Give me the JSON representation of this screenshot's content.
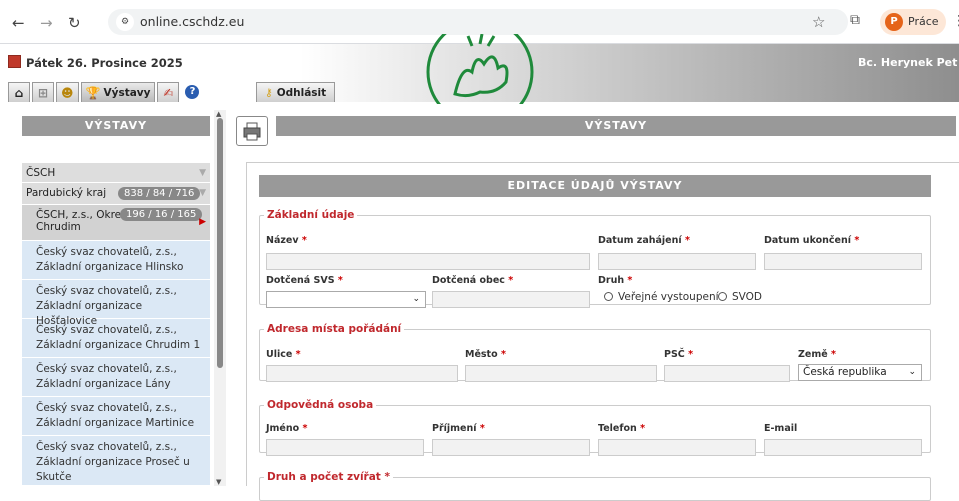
{
  "browser": {
    "url": "online.cschdz.eu",
    "profile_name": "Práce",
    "profile_initial": "P"
  },
  "header": {
    "date": "Pátek 26. Prosince 2025",
    "user": "Bc. Herynek Pet",
    "tabs": [
      {
        "icon": "home-icon",
        "label": ""
      },
      {
        "icon": "sitemap-icon",
        "label": ""
      },
      {
        "icon": "people-icon",
        "label": ""
      },
      {
        "icon": "trophy-icon",
        "label": "Výstavy"
      },
      {
        "icon": "pen-icon",
        "label": ""
      },
      {
        "icon": "help-icon",
        "label": ""
      }
    ],
    "logout": "Odhlásit"
  },
  "sidebar": {
    "title": "VÝSTAVY",
    "tree": {
      "root": "ČSCH",
      "region": {
        "label": "Pardubický kraj",
        "counts": "838 / 84 / 716"
      },
      "district": {
        "label": "ČSCH, z.s., Okresní",
        "label2": "Chrudim",
        "counts": "196 / 16 / 165"
      }
    },
    "orgs": [
      {
        "line1": "Český svaz chovatelů, z.s.,",
        "line2": "Základní organizace Hlinsko"
      },
      {
        "line1": "Český svaz chovatelů, z.s.,",
        "line2": "Základní organizace Hošťalovice"
      },
      {
        "line1": "Český svaz chovatelů, z.s.,",
        "line2": "Základní organizace Chrudim 1"
      },
      {
        "line1": "Český svaz chovatelů, z.s.,",
        "line2": "Základní organizace Lány"
      },
      {
        "line1": "Český svaz chovatelů, z.s.,",
        "line2": "Základní organizace Martinice"
      },
      {
        "line1": "Český svaz chovatelů, z.s.,",
        "line2": "Základní organizace Proseč u",
        "line3": "Skutče"
      }
    ]
  },
  "main": {
    "title": "VÝSTAVY",
    "panel_title": "EDITACE ÚDAJŮ VÝSTAVY",
    "basic": {
      "legend": "Základní údaje",
      "name": "Název",
      "start": "Datum zahájení",
      "end": "Datum ukončení",
      "svs": "Dotčená SVS",
      "obec": "Dotčená obec",
      "druh": "Druh",
      "radio1": "Veřejné vystoupení",
      "radio2": "SVOD"
    },
    "address": {
      "legend": "Adresa místa pořádání",
      "street": "Ulice",
      "city": "Město",
      "zip": "PSČ",
      "country": "Země",
      "country_value": "Česká republika"
    },
    "person": {
      "legend": "Odpovědná osoba",
      "first": "Jméno",
      "last": "Příjmení",
      "phone": "Telefon",
      "email": "E-mail"
    },
    "animals": {
      "legend": "Druh a počet zvířat"
    },
    "required_mark": "*"
  },
  "colors": {
    "legend_red": "#c0282d",
    "header_gray": "#999999",
    "org_blue": "#dbe8f5"
  }
}
